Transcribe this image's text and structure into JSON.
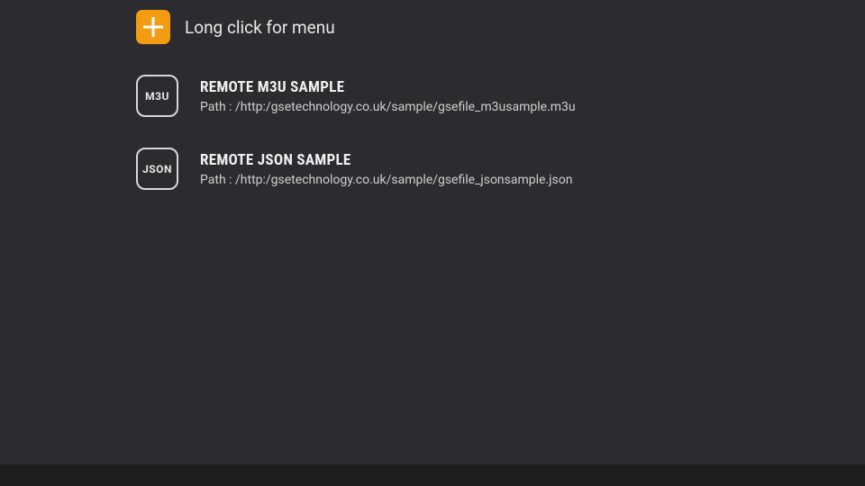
{
  "header": {
    "hint": "Long click for menu"
  },
  "playlists": [
    {
      "icon_label": "M3U",
      "title": "REMOTE M3U SAMPLE",
      "path_prefix": "Path : ",
      "path": "/http:/gsetechnology.co.uk/sample/gsefile_m3usample.m3u"
    },
    {
      "icon_label": "JSON",
      "title": "REMOTE JSON SAMPLE",
      "path_prefix": "Path : ",
      "path": "/http:/gsetechnology.co.uk/sample/gsefile_jsonsample.json"
    }
  ],
  "colors": {
    "accent": "#f39c12",
    "background": "#2c2c30",
    "footer": "#1e1e21"
  }
}
